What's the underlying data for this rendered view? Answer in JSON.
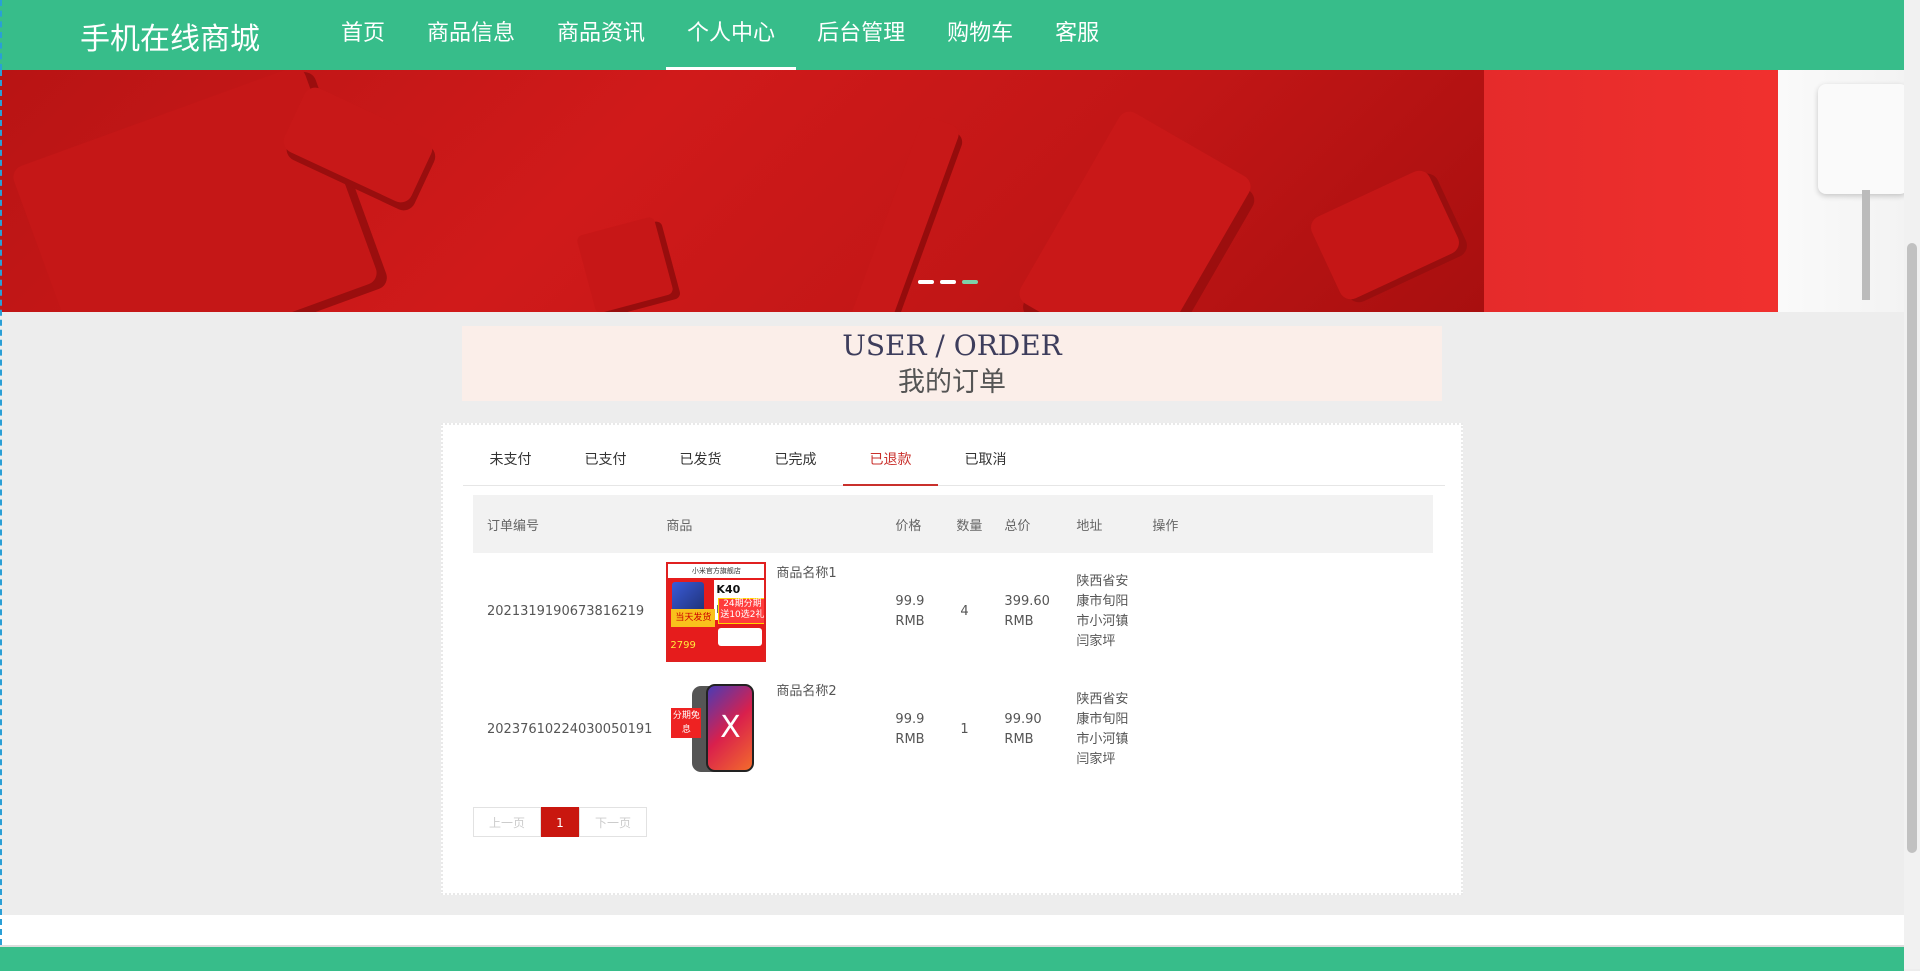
{
  "brand": "手机在线商城",
  "nav": {
    "items": [
      {
        "label": "首页"
      },
      {
        "label": "商品信息"
      },
      {
        "label": "商品资讯"
      },
      {
        "label": "个人中心",
        "active": true
      },
      {
        "label": "后台管理"
      },
      {
        "label": "购物车"
      },
      {
        "label": "客服"
      }
    ]
  },
  "banner": {
    "slide_count": 3,
    "active_slide": 3
  },
  "title": {
    "en": "USER / ORDER",
    "cn": "我的订单"
  },
  "tabs": [
    {
      "label": "未支付"
    },
    {
      "label": "已支付"
    },
    {
      "label": "已发货"
    },
    {
      "label": "已完成"
    },
    {
      "label": "已退款",
      "active": true
    },
    {
      "label": "已取消"
    }
  ],
  "table": {
    "headers": {
      "order_no": "订单编号",
      "product": "商品",
      "price": "价格",
      "qty": "数量",
      "total": "总价",
      "address": "地址",
      "action": "操作"
    },
    "rows": [
      {
        "order_no": "2021319190673816219",
        "product_name": "商品名称1",
        "price": "99.9 RMB",
        "qty": "4",
        "total": "399.60 RMB",
        "address": "陕西省安康市旬阳市小河镇闫家坪",
        "thumb_text": {
          "head": "小米官方旗舰店",
          "model": "K40 Pro",
          "badge1": "当天发货",
          "badge2": "24期分期 送10选2礼",
          "price": "2799"
        }
      },
      {
        "order_no": "20237610224030050191",
        "product_name": "商品名称2",
        "price": "99.9 RMB",
        "qty": "1",
        "total": "99.90 RMB",
        "address": "陕西省安康市旬阳市小河镇闫家坪",
        "thumb_text": {
          "tag": "分期免息",
          "mark": "X"
        }
      }
    ]
  },
  "pager": {
    "prev": "上一页",
    "current": "1",
    "next": "下一页"
  },
  "colors": {
    "primary": "#37bd8a",
    "accent": "#c9302c",
    "pager_active": "#c9170f",
    "title_bg": "#fbeee9"
  }
}
